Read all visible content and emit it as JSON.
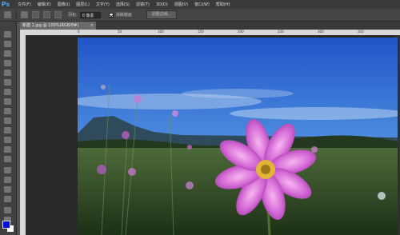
{
  "app": {
    "logo": "Ps"
  },
  "menu": {
    "items": [
      "文件(F)",
      "编辑(E)",
      "图像(I)",
      "图层(L)",
      "文字(Y)",
      "选择(S)",
      "滤镜(T)",
      "3D(D)",
      "视图(V)",
      "窗口(W)",
      "帮助(H)"
    ]
  },
  "options": {
    "feather_label": "羽化:",
    "feather_value": "0 像素",
    "antialias_label": "消除锯齿",
    "antialias_checked": true,
    "refine_edge_label": "调整边缘..."
  },
  "document": {
    "tab_label": "新建 1.jpg @ 100%(RGB/8#)",
    "close_glyph": "×"
  },
  "ruler": {
    "top_ticks": [
      "0",
      "50",
      "100",
      "150",
      "200",
      "250",
      "300",
      "350"
    ]
  },
  "colors": {
    "foreground": "#0010d8",
    "background": "#ffffff"
  },
  "icons": {
    "tools": [
      "move-icon",
      "marquee-icon",
      "lasso-icon",
      "quick-select-icon",
      "crop-icon",
      "eyedropper-icon",
      "healing-icon",
      "brush-icon",
      "clone-stamp-icon",
      "history-brush-icon",
      "eraser-icon",
      "gradient-icon",
      "blur-icon",
      "dodge-icon",
      "pen-icon",
      "type-icon",
      "path-select-icon",
      "shape-icon",
      "hand-icon",
      "zoom-icon"
    ]
  }
}
